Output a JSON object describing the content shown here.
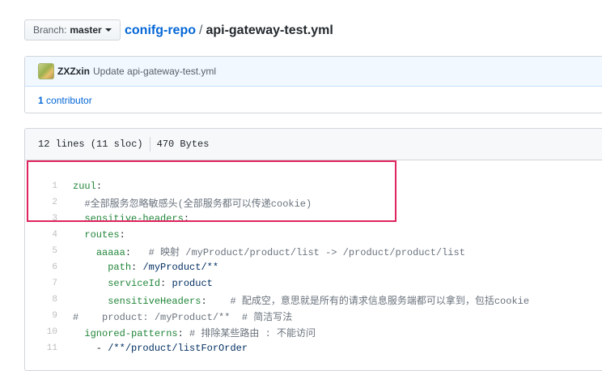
{
  "branch": {
    "label": "Branch:",
    "name": "master"
  },
  "breadcrumb": {
    "repo": "conifg-repo",
    "separator": "/",
    "file": "api-gateway-test.yml"
  },
  "commit": {
    "author": "ZXZxin",
    "message": "Update api-gateway-test.yml"
  },
  "contributors": {
    "count": "1",
    "label": "contributor"
  },
  "file_info": {
    "lines": "12 lines (11 sloc)",
    "size": "470 Bytes"
  },
  "code_lines": [
    {
      "num": "1",
      "parts": [
        {
          "t": "k",
          "v": "zuul"
        },
        {
          "t": "n",
          "v": ":"
        }
      ]
    },
    {
      "num": "2",
      "parts": [
        {
          "t": "c",
          "v": "  #全部服务忽略敏感头(全部服务都可以传递cookie)"
        }
      ]
    },
    {
      "num": "3",
      "parts": [
        {
          "t": "n",
          "v": "  "
        },
        {
          "t": "k",
          "v": "sensitive-headers"
        },
        {
          "t": "n",
          "v": ":"
        }
      ]
    },
    {
      "num": "4",
      "parts": [
        {
          "t": "n",
          "v": "  "
        },
        {
          "t": "k",
          "v": "routes"
        },
        {
          "t": "n",
          "v": ":"
        }
      ]
    },
    {
      "num": "5",
      "parts": [
        {
          "t": "n",
          "v": "    "
        },
        {
          "t": "k",
          "v": "aaaaa"
        },
        {
          "t": "n",
          "v": ":   "
        },
        {
          "t": "c",
          "v": "# 映射 /myProduct/product/list -> /product/product/list"
        }
      ]
    },
    {
      "num": "6",
      "parts": [
        {
          "t": "n",
          "v": "      "
        },
        {
          "t": "k",
          "v": "path"
        },
        {
          "t": "n",
          "v": ": "
        },
        {
          "t": "s",
          "v": "/myProduct/**"
        }
      ]
    },
    {
      "num": "7",
      "parts": [
        {
          "t": "n",
          "v": "      "
        },
        {
          "t": "k",
          "v": "serviceId"
        },
        {
          "t": "n",
          "v": ": "
        },
        {
          "t": "s",
          "v": "product"
        }
      ]
    },
    {
      "num": "8",
      "parts": [
        {
          "t": "n",
          "v": "      "
        },
        {
          "t": "k",
          "v": "sensitiveHeaders"
        },
        {
          "t": "n",
          "v": ":    "
        },
        {
          "t": "c",
          "v": "# 配成空，意思就是所有的请求信息服务端都可以拿到，包括cookie"
        }
      ]
    },
    {
      "num": "9",
      "parts": [
        {
          "t": "c",
          "v": "#    product: /myProduct/**  # 简洁写法"
        }
      ]
    },
    {
      "num": "10",
      "parts": [
        {
          "t": "n",
          "v": "  "
        },
        {
          "t": "k",
          "v": "ignored-patterns"
        },
        {
          "t": "n",
          "v": ": "
        },
        {
          "t": "c",
          "v": "# 排除某些路由 : 不能访问"
        }
      ]
    },
    {
      "num": "11",
      "parts": [
        {
          "t": "n",
          "v": "    - "
        },
        {
          "t": "s",
          "v": "/**/product/listForOrder"
        }
      ]
    }
  ],
  "colors": {
    "link": "#0366d6",
    "key": "#22863a",
    "comment": "#6a737d",
    "string": "#032f62",
    "highlight": "#e0245e"
  }
}
